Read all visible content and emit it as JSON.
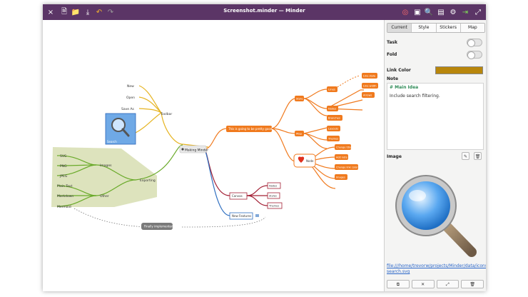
{
  "window": {
    "title": "Screenshot.minder — Minder"
  },
  "toolbar": {
    "close": "×",
    "new": "🗎",
    "open": "📁",
    "save": "⤓",
    "undo": "↶",
    "redo": "↷",
    "target": "◎",
    "stack": "▣",
    "search": "🔍",
    "image": "▤",
    "gear": "⚙",
    "focus": "⇥",
    "fullscreen": "⤢"
  },
  "canvas": {
    "nodes": {
      "root": "Making Minder",
      "toolbar": "Toolbar",
      "new": "New",
      "open": "Open",
      "save_as": "Save As",
      "search": "Search",
      "exporting": "Exporting",
      "images": "Images",
      "svg": "SVG",
      "png": "PNG",
      "jpeg": "JPEG",
      "other": "Other",
      "plain_text": "Plain Text",
      "markdown": "Markdown",
      "mermaid": "Mermaid",
      "pretty_good": "This is going to be pretty good",
      "style": "Style",
      "lines": "Lines",
      "line_style": "Line style",
      "line_width": "Line width",
      "arrows": "Arrows",
      "nodes_o": "Nodes",
      "branches": "Branches",
      "map": "Map",
      "layouts": "Layouts",
      "themes_o": "Themes",
      "node": "Node",
      "change_title": "Change title",
      "add_note": "Add note",
      "change_link_color": "Change link color",
      "images_o": "Images",
      "canvas": "Canvas",
      "nodes_r": "Nodes",
      "styles_r": "Styles",
      "themes_r": "Themes",
      "new_features": "New Features",
      "finally_implemented": "Finally implemented"
    }
  },
  "sidebar": {
    "tabs": [
      "Current",
      "Style",
      "Stickers",
      "Map"
    ],
    "active_tab": "Current",
    "task_label": "Task",
    "fold_label": "Fold",
    "link_color_label": "Link Color",
    "link_color": "#b8860b",
    "note_label": "Note",
    "note_title": "# Main Idea",
    "note_text": "Include search filtering.",
    "image_label": "Image",
    "edit_icon": "✎",
    "delete_icon": "🗑",
    "image_path": "file:///home/trevorw/projects/Minder/data/icons/scalable/minder-search.svg",
    "bottom_buttons": [
      "⧉",
      "✕",
      "⤢",
      "🗑"
    ]
  },
  "colors": {
    "titlebar": "#5b3566",
    "orange": "#f07a1e",
    "yellow": "#e6b422",
    "green": "#6aaa2a",
    "red": "#a32035",
    "blue": "#2f6fc0"
  }
}
